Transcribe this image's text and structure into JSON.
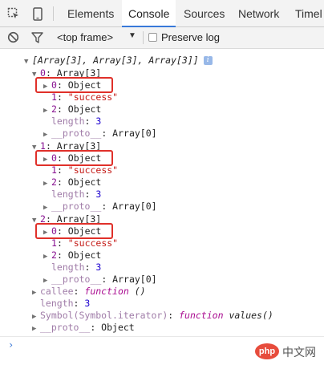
{
  "toolbar": {
    "tabs": [
      "Elements",
      "Console",
      "Sources",
      "Network",
      "Timel"
    ],
    "active_tab": "Console",
    "accent_color": "#3879d9"
  },
  "filter": {
    "frame_selector": "<top frame>",
    "preserve_log_label": "Preserve log",
    "preserve_log_checked": false
  },
  "console": {
    "root_summary": "[Array[3], Array[3], Array[3]]",
    "root_info_badge": "i",
    "groups": [
      {
        "header_key": "0",
        "header_val": "Array[3]",
        "item0_key": "0",
        "item0_val": "Object",
        "item1_key": "1",
        "item1_val": "\"success\"",
        "item2_key": "2",
        "item2_val": "Object",
        "length_key": "length",
        "length_val": "3",
        "proto_key": "__proto__",
        "proto_val": "Array[0]"
      },
      {
        "header_key": "1",
        "header_val": "Array[3]",
        "item0_key": "0",
        "item0_val": "Object",
        "item1_key": "1",
        "item1_val": "\"success\"",
        "item2_key": "2",
        "item2_val": "Object",
        "length_key": "length",
        "length_val": "3",
        "proto_key": "__proto__",
        "proto_val": "Array[0]"
      },
      {
        "header_key": "2",
        "header_val": "Array[3]",
        "item0_key": "0",
        "item0_val": "Object",
        "item1_key": "1",
        "item1_val": "\"success\"",
        "item2_key": "2",
        "item2_val": "Object",
        "length_key": "length",
        "length_val": "3",
        "proto_key": "__proto__",
        "proto_val": "Array[0]"
      }
    ],
    "callee_key": "callee",
    "callee_kw": "function",
    "callee_val": "()",
    "length_key": "length",
    "length_val": "3",
    "symbol_key": "Symbol(Symbol.iterator)",
    "symbol_kw": "function",
    "symbol_val": "values()",
    "proto_key": "__proto__",
    "proto_val": "Object",
    "highlight_color": "#e0302a"
  },
  "prompt": {
    "symbol": "›"
  },
  "watermark": {
    "logo_text": "php",
    "site_text": "中文网"
  }
}
